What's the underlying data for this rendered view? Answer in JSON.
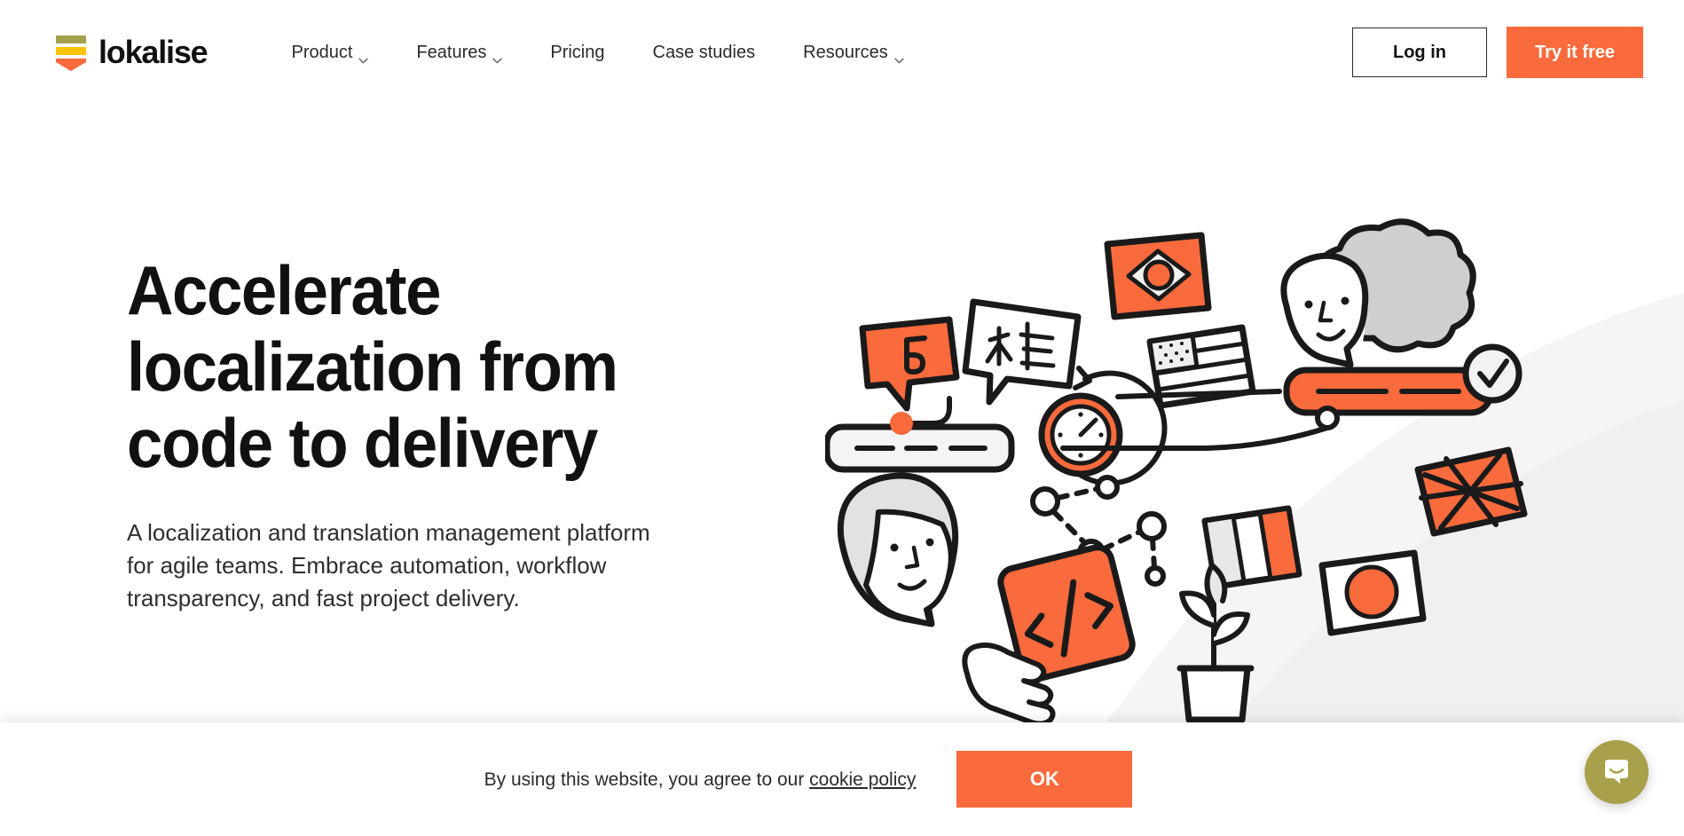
{
  "brand": {
    "name": "lokalise",
    "logo_icon": "lokalise-bars-icon",
    "accent_color": "#F96A3C",
    "logo_bar_colors": [
      "#A3A04C",
      "#FFC400",
      "#F96A3C"
    ]
  },
  "header": {
    "nav": [
      {
        "label": "Product",
        "has_dropdown": true,
        "icon": "chevron-down-icon"
      },
      {
        "label": "Features",
        "has_dropdown": true,
        "icon": "chevron-down-icon"
      },
      {
        "label": "Pricing",
        "has_dropdown": false,
        "icon": ""
      },
      {
        "label": "Case studies",
        "has_dropdown": false,
        "icon": ""
      },
      {
        "label": "Resources",
        "has_dropdown": true,
        "icon": "chevron-down-icon"
      }
    ],
    "login_label": "Log in",
    "cta_label": "Try it free"
  },
  "hero": {
    "title_lines": [
      "Accelerate",
      "localization from",
      "code to delivery"
    ],
    "title_full": "Accelerate localization from code to delivery",
    "subtitle": "A localization and translation management platform for agile teams. Embrace automation, workflow transparency, and fast project delivery.",
    "illustration": {
      "name": "localization-doodle-illustration",
      "elements": [
        "speech-bubble-cyrillic-b",
        "speech-bubble-chinese-characters",
        "brazil-flag",
        "usa-flag",
        "italy-flag",
        "japan-flag",
        "uk-flag",
        "clock-with-arrow",
        "person-face-curly-hair",
        "person-face-bob-hair",
        "orange-progress-bar",
        "check-circle",
        "grey-progress-bar",
        "node-graph",
        "hand-holding-code-tag",
        "potted-plant"
      ],
      "bubble_b_text": "Б",
      "code_tag_text": "</>"
    }
  },
  "cookie_banner": {
    "text_prefix": "By using this website, you agree to our",
    "link_label": "cookie policy",
    "accept_label": "OK"
  },
  "chat": {
    "launcher_icon": "chat-bubble-smile-icon",
    "launcher_color": "#A8A04A"
  }
}
